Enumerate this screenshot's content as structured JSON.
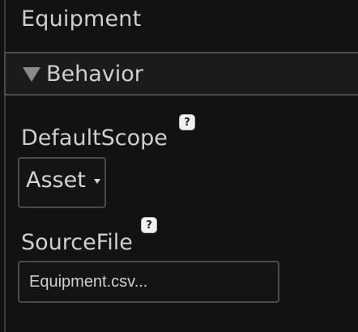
{
  "panel": {
    "title": "Equipment"
  },
  "section": {
    "label": "Behavior",
    "expanded": true
  },
  "fields": {
    "default_scope": {
      "label": "DefaultScope",
      "value": "Asset",
      "help_glyph": "?"
    },
    "source_file": {
      "label": "SourceFile",
      "value": "Equipment.csv...",
      "help_glyph": "?"
    }
  },
  "icons": {
    "section_toggle": "triangle-down-icon",
    "help": "help-question-icon",
    "dropdown": "caret-down-icon"
  },
  "colors": {
    "background": "#121212",
    "text": "#cfcfcf",
    "border": "#4a4a4a",
    "help_icon_bg": "#f2f2f2"
  }
}
